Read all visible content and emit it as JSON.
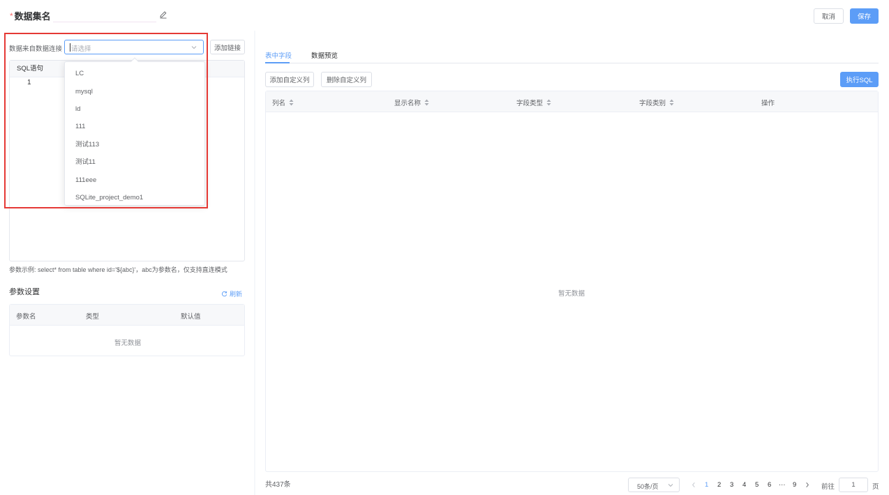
{
  "header": {
    "required_mark": "*",
    "title": "数据集名",
    "cancel_label": "取消",
    "save_label": "保存"
  },
  "left": {
    "source_label": "数据来自数据连接",
    "select_placeholder": "请选择",
    "add_link_label": "添加链接",
    "sql_header": "SQL语句",
    "line_number": "1",
    "dropdown_options": [
      "LC",
      "mysql",
      "ld",
      "111",
      "测试113",
      "测试11",
      "111eee",
      "SQLite_project_demo1"
    ],
    "hint": "参数示例: select* from table where id='${abc}'，abc为参数名，仅支持直连模式",
    "params": {
      "title": "参数设置",
      "refresh_label": "刷新",
      "columns": [
        "参数名",
        "类型",
        "默认值"
      ],
      "empty_text": "暂无数据"
    }
  },
  "right": {
    "tabs": [
      "表中字段",
      "数据预览"
    ],
    "add_custom_label": "添加自定义列",
    "delete_custom_label": "删除自定义列",
    "run_sql_label": "执行SQL",
    "columns": [
      "列名",
      "显示名称",
      "字段类型",
      "字段类别",
      "操作"
    ],
    "empty_text": "暂无数据"
  },
  "pagination": {
    "total": "共437条",
    "page_size": "50条/页",
    "pages": [
      "1",
      "2",
      "3",
      "4",
      "5",
      "6",
      "···",
      "9"
    ],
    "current_page": "1",
    "goto_prefix": "前往",
    "goto_value": "1",
    "goto_suffix": "页"
  },
  "colors": {
    "primary": "#5c9df7",
    "highlight_box": "#e53935",
    "required": "#f56c6c"
  }
}
